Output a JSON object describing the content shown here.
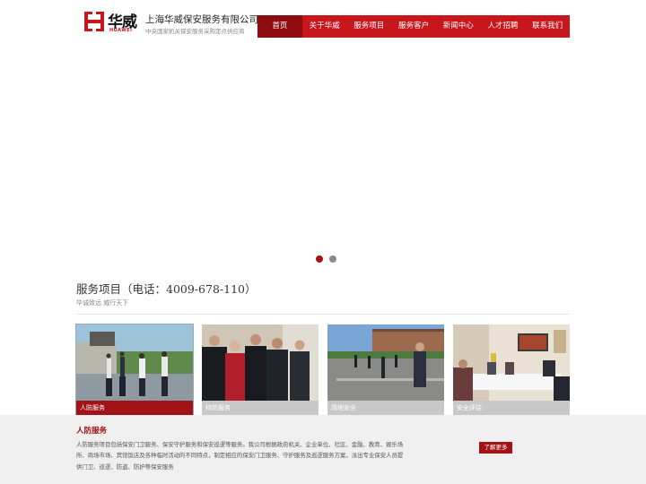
{
  "brand": {
    "logo_cn": "华威",
    "logo_en": "HUAWEI",
    "company_name": "上海华威保安服务有限公司",
    "company_sub": "中央国家机关保安服务采购定点供应商",
    "accent_color": "#c8161d"
  },
  "nav": {
    "items": [
      {
        "label": "首页",
        "active": true
      },
      {
        "label": "关于华威"
      },
      {
        "label": "服务项目"
      },
      {
        "label": "服务客户"
      },
      {
        "label": "新闻中心"
      },
      {
        "label": "人才招聘"
      },
      {
        "label": "联系我们"
      }
    ]
  },
  "slider": {
    "dots": 2,
    "active_index": 0
  },
  "services": {
    "title": "服务项目（电话：4009-678-110）",
    "subtitle": "华诚致远 威行天下",
    "cards": [
      {
        "label": "人防服务",
        "active": true
      },
      {
        "label": "特防服务"
      },
      {
        "label": "场地安全"
      },
      {
        "label": "安全评估"
      }
    ]
  },
  "detail": {
    "title": "人防服务",
    "description": "人防服务项目包括保安门卫服务、保安守护服务和保安巡逻等服务。我公司根据政府机关、企业单位、社区、金融、教育、娱乐场所、商场市场、宾馆饭店及各种临时活动的不同特点，制定相应的保安门卫服务、守护服务及巡逻服务方案，派出专业保安人员提供门卫、巡逻、防盗、防护等保安服务",
    "more_label": "了解更多"
  }
}
